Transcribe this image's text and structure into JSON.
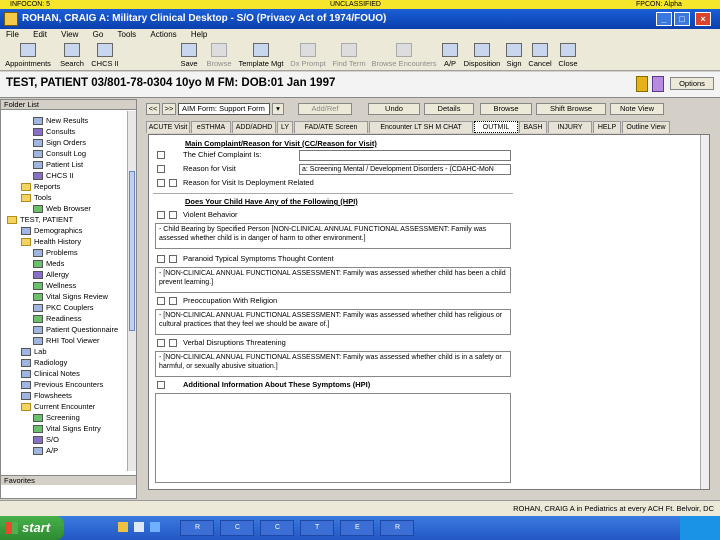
{
  "classification": {
    "left": "INFOCON: 5",
    "center": "UNCLASSIFIED",
    "right": "FPCON: Alpha"
  },
  "window": {
    "title": "ROHAN, CRAIG A: Military Clinical Desktop - S/O (Privacy Act of 1974/FOUO)",
    "minimize": "_",
    "maximize": "□",
    "close": "×"
  },
  "menu": [
    "File",
    "Edit",
    "View",
    "Go",
    "Tools",
    "Actions",
    "Help"
  ],
  "toolbar": {
    "left": [
      {
        "label": "Appointments",
        "icon": "calendar-icon"
      },
      {
        "label": "Search",
        "icon": "search-icon"
      },
      {
        "label": "CHCS II",
        "icon": "chcs-icon"
      }
    ],
    "right": [
      {
        "label": "Save",
        "icon": "save-icon",
        "enabled": true
      },
      {
        "label": "Browse",
        "icon": "browse-icon",
        "enabled": false
      },
      {
        "label": "Template Mgt",
        "icon": "template-icon",
        "enabled": true
      },
      {
        "label": "Dx Prompt",
        "icon": "dx-prompt-icon",
        "enabled": false
      },
      {
        "label": "Find Term",
        "icon": "find-term-icon",
        "enabled": false
      },
      {
        "label": "Browse Encounters",
        "icon": "browse-encounters-icon",
        "enabled": false
      },
      {
        "label": "A/P",
        "icon": "ap-icon",
        "enabled": true
      },
      {
        "label": "Disposition",
        "icon": "disposition-icon",
        "enabled": true
      },
      {
        "label": "Sign",
        "icon": "sign-icon",
        "enabled": true
      },
      {
        "label": "Cancel",
        "icon": "cancel-icon",
        "enabled": true
      },
      {
        "label": "Close",
        "icon": "close-icon",
        "enabled": true
      }
    ]
  },
  "patient": {
    "banner": "TEST, PATIENT 03/801-78-0304 10yo M FM: DOB:01 Jan 1997",
    "options": "Options"
  },
  "sidebar": {
    "header": "Folder List",
    "footer": "Favorites",
    "items": [
      {
        "label": "New Results",
        "icon": "results-icon",
        "level": 2
      },
      {
        "label": "Consults",
        "icon": "consults-icon",
        "level": 2
      },
      {
        "label": "Sign Orders",
        "icon": "sign-orders-icon",
        "level": 2
      },
      {
        "label": "Consult Log",
        "icon": "consult-log-icon",
        "level": 2
      },
      {
        "label": "Patient List",
        "icon": "patient-list-icon",
        "level": 2
      },
      {
        "label": "CHCS II",
        "icon": "chcs-icon",
        "level": 2
      },
      {
        "label": "Reports",
        "icon": "folder-icon",
        "level": 1
      },
      {
        "label": "Tools",
        "icon": "folder-icon",
        "level": 1
      },
      {
        "label": "Web Browser",
        "icon": "web-browser-icon",
        "level": 2
      },
      {
        "label": "TEST, PATIENT",
        "icon": "folder-icon",
        "level": 0
      },
      {
        "label": "Demographics",
        "icon": "demographics-icon",
        "level": 1
      },
      {
        "label": "Health History",
        "icon": "folder-icon",
        "level": 1
      },
      {
        "label": "Problems",
        "icon": "problems-icon",
        "level": 2
      },
      {
        "label": "Meds",
        "icon": "meds-icon",
        "level": 2
      },
      {
        "label": "Allergy",
        "icon": "allergy-icon",
        "level": 2
      },
      {
        "label": "Wellness",
        "icon": "wellness-icon",
        "level": 2
      },
      {
        "label": "Vital Signs Review",
        "icon": "vitals-icon",
        "level": 2
      },
      {
        "label": "PKC Couplers",
        "icon": "pkc-icon",
        "level": 2
      },
      {
        "label": "Readiness",
        "icon": "readiness-icon",
        "level": 2
      },
      {
        "label": "Patient Questionnaire",
        "icon": "questionnaire-icon",
        "level": 2
      },
      {
        "label": "RHI Tool Viewer",
        "icon": "viewer-icon",
        "level": 2
      },
      {
        "label": "Lab",
        "icon": "lab-icon",
        "level": 1
      },
      {
        "label": "Radiology",
        "icon": "radiology-icon",
        "level": 1
      },
      {
        "label": "Clinical Notes",
        "icon": "notes-icon",
        "level": 1
      },
      {
        "label": "Previous Encounters",
        "icon": "encounters-icon",
        "level": 1
      },
      {
        "label": "Flowsheets",
        "icon": "flowsheets-icon",
        "level": 1
      },
      {
        "label": "Current Encounter",
        "icon": "folder-icon",
        "level": 1
      },
      {
        "label": "Screening",
        "icon": "screening-icon",
        "level": 2
      },
      {
        "label": "Vital Signs Entry",
        "icon": "vitals-entry-icon",
        "level": 2
      },
      {
        "label": "S/O",
        "icon": "so-icon",
        "level": 2
      },
      {
        "label": "A/P",
        "icon": "ap-icon",
        "level": 2
      }
    ]
  },
  "main": {
    "nav": {
      "prev": "<<",
      "next": ">>",
      "form_select": "AIM Form: Support Form",
      "add_to_list": "Add/Ref",
      "undo": "Undo",
      "details": "Details",
      "browse": "Browse",
      "shift_browse": "Shift Browse",
      "note_view": "Note View"
    },
    "tabs": [
      {
        "label": "ACUTE Visit",
        "active": false
      },
      {
        "label": "eSTHMA",
        "active": false
      },
      {
        "label": "ADD/ADHD",
        "active": false
      },
      {
        "label": "LY",
        "active": false
      },
      {
        "label": "FAD/ATE Screen",
        "active": false
      },
      {
        "label": "Encounter LT SH M CHAT",
        "active": false
      },
      {
        "label": "OUTMIL",
        "active": true
      },
      {
        "label": "BASH",
        "active": false
      },
      {
        "label": "INJURY",
        "active": false
      },
      {
        "label": "HELP",
        "active": false
      },
      {
        "label": "Outline View",
        "active": false
      }
    ],
    "form": {
      "section1_title": "Main Complaint/Reason for Visit (CC/Reason for Visit)",
      "chief_complaint_label": "The Chief Complaint Is:",
      "chief_complaint_value": "",
      "reason_label": "Reason for Visit",
      "reason_value": "a: Screening Mental / Development Disorders - (CDAHC-MoN",
      "deployment_label": "Reason for Visit Is Deployment Related",
      "section2_title": "Does Your Child Have Any of the Following (HPI)",
      "items": [
        {
          "label": "Violent Behavior",
          "text": "- Child Bearing by Specified Person [NON-CLINICAL ANNUAL FUNCTIONAL ASSESSMENT: Family was assessed whether child is in danger of harm to other environment.]"
        },
        {
          "label": "Paranoid Typical Symptoms Thought Content",
          "text": "- [NON-CLINICAL ANNUAL FUNCTIONAL ASSESSMENT: Family was assessed whether child has been a child prevent learning.]"
        },
        {
          "label": "Preoccupation With Religion",
          "text": "- [NON-CLINICAL ANNUAL FUNCTIONAL ASSESSMENT: Family was assessed whether child has religious or cultural practices that they feel we should be aware of.]"
        },
        {
          "label": "Verbal Disruptions Threatening",
          "text": "- [NON-CLINICAL ANNUAL FUNCTIONAL ASSESSMENT: Family was assessed whether child is in a safety or harmful, or sexually abusive situation.]"
        }
      ],
      "section3_title": "Additional Information About These Symptoms (HPI)",
      "additional_value": ""
    }
  },
  "status": {
    "text": "ROHAN, CRAIG A in Pediatrics at every ACH Ft. Belvoir, DC"
  },
  "taskbar": {
    "start": "start",
    "tasks": [
      "R",
      "C",
      "C",
      "T",
      "E",
      "R"
    ]
  }
}
